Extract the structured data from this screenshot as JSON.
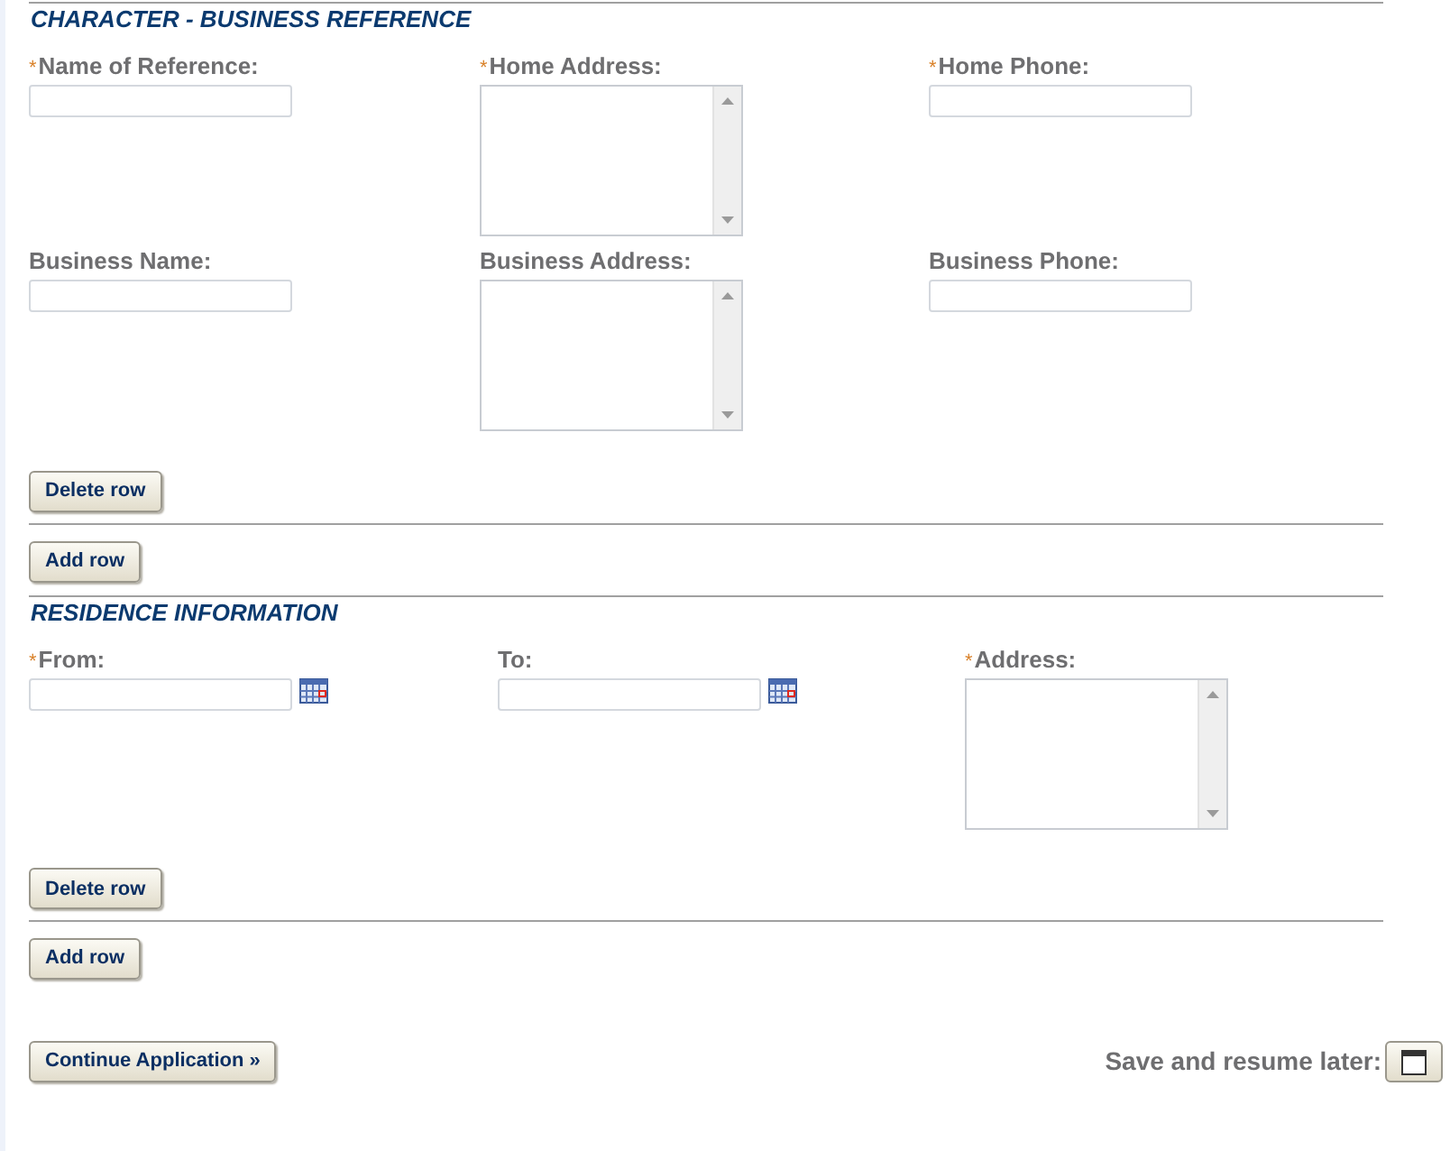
{
  "sections": [
    {
      "title": "CHARACTER - BUSINESS REFERENCE",
      "fields": [
        {
          "label": "Name of Reference:",
          "required_mark": "*",
          "kind": "text"
        },
        {
          "label": "Home Address:",
          "required_mark": "*",
          "kind": "textarea"
        },
        {
          "label": "Home Phone:",
          "required_mark": "*",
          "kind": "text"
        },
        {
          "label": "Business Name:",
          "kind": "text"
        },
        {
          "label": "Business Address:",
          "kind": "textarea"
        },
        {
          "label": "Business Phone:",
          "kind": "text"
        }
      ],
      "delete_button": "Delete row",
      "add_button": "Add row"
    },
    {
      "title": "RESIDENCE INFORMATION",
      "fields": [
        {
          "label": "From:",
          "required_mark": "*",
          "kind": "date"
        },
        {
          "label": "To:",
          "kind": "date"
        },
        {
          "label": "Address:",
          "required_mark": "*",
          "kind": "textarea"
        }
      ],
      "delete_button": "Delete row",
      "add_button": "Add row"
    }
  ],
  "continue_button": "Continue Application »",
  "save_label": "Save and resume later:"
}
